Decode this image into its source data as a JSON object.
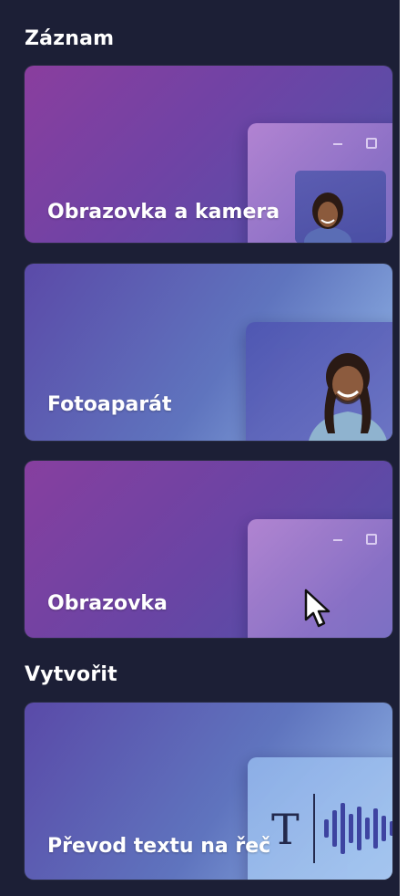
{
  "sections": {
    "record_title": "Záznam",
    "create_title": "Vytvořit"
  },
  "cards": {
    "screen_and_camera": "Obrazovka a kamera",
    "camera": "Fotoaparát",
    "screen": "Obrazovka",
    "text_to_speech": "Převod textu na řeč"
  },
  "icons": {
    "text_icon_glyph": "T"
  },
  "colors": {
    "panel_bg": "#1c1f36",
    "purple": "#7a3fa8",
    "indigo": "#4b4fa6",
    "light_blue": "#8fb3e6"
  }
}
